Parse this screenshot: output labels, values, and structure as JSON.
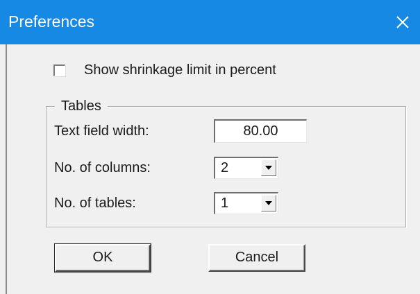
{
  "window": {
    "title": "Preferences",
    "title_bar_color": "#1589e4",
    "close_icon": "close-icon"
  },
  "options": {
    "show_shrinkage_label": "Show shrinkage limit in percent",
    "show_shrinkage_checked": false
  },
  "tables_group": {
    "legend": "Tables",
    "text_field_width_label": "Text field width:",
    "text_field_width_value": "80.00",
    "columns_label": "No. of columns:",
    "columns_value": "2",
    "tables_label": "No. of tables:",
    "tables_value": "1",
    "dropdown_icon": "chevron-down-icon"
  },
  "buttons": {
    "ok_label": "OK",
    "cancel_label": "Cancel"
  }
}
